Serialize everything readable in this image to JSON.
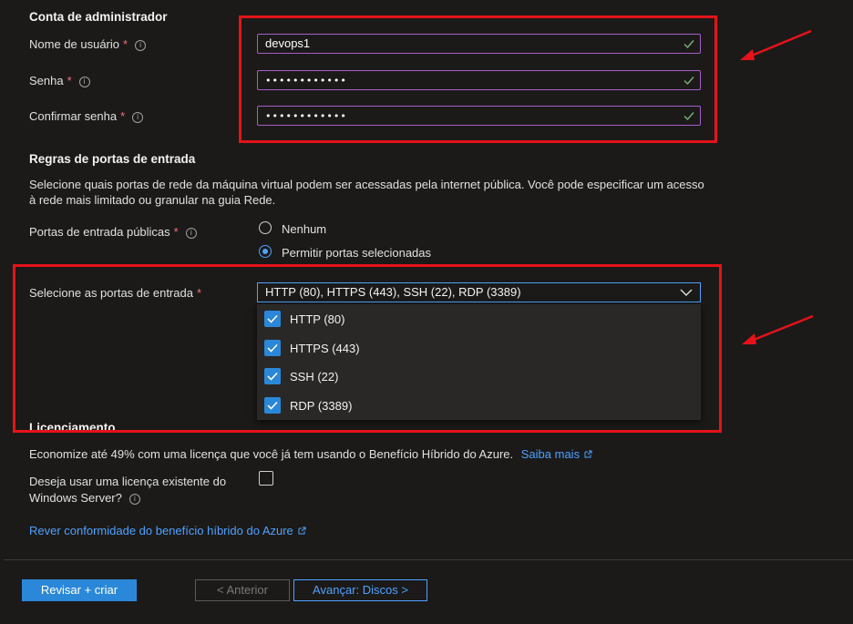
{
  "admin": {
    "heading": "Conta de administrador",
    "username_label": "Nome de usuário",
    "username_value": "devops1",
    "password_label": "Senha",
    "password_value": "••••••••••••",
    "confirm_label": "Confirmar senha",
    "confirm_value": "••••••••••••"
  },
  "inbound": {
    "heading": "Regras de portas de entrada",
    "description_line1": "Selecione quais portas de rede da máquina virtual podem ser acessadas pela internet pública. Você pode especificar um acesso",
    "description_line2": "à rede mais limitado ou granular na guia Rede.",
    "public_ports_label": "Portas de entrada públicas",
    "option_none": "Nenhum",
    "option_allow": "Permitir portas selecionadas",
    "selected_option": "Permitir portas selecionadas",
    "select_label": "Selecione as portas de entrada",
    "select_value": "HTTP (80), HTTPS (443), SSH (22), RDP (3389)",
    "options": [
      {
        "label": "HTTP (80)",
        "checked": true
      },
      {
        "label": "HTTPS (443)",
        "checked": true
      },
      {
        "label": "SSH (22)",
        "checked": true
      },
      {
        "label": "RDP (3389)",
        "checked": true
      }
    ]
  },
  "licensing": {
    "heading": "Licenciamento",
    "savings_text": "Economize até 49% com uma licença que você já tem usando o Benefício Híbrido do Azure.",
    "learn_more": "Saiba mais",
    "existing_license_line1": "Deseja usar uma licença existente do",
    "existing_license_line2": "Windows Server?",
    "existing_license_checked": false,
    "compliance_link": "Rever conformidade do benefício híbrido do Azure"
  },
  "footer": {
    "review_create": "Revisar + criar",
    "previous": "< Anterior",
    "next": "Avançar: Discos >"
  },
  "colors": {
    "accent": "#4ea1ff",
    "primary_button": "#2b88d8",
    "annotation": "#e5121a",
    "input_border": "#a85cc6",
    "valid_check": "#7ab37a"
  },
  "icons": {
    "info": "info-icon",
    "valid": "checkmark-icon",
    "chevron": "chevron-down-icon",
    "external": "external-link-icon",
    "annotation_arrow": "red-arrow-icon"
  }
}
